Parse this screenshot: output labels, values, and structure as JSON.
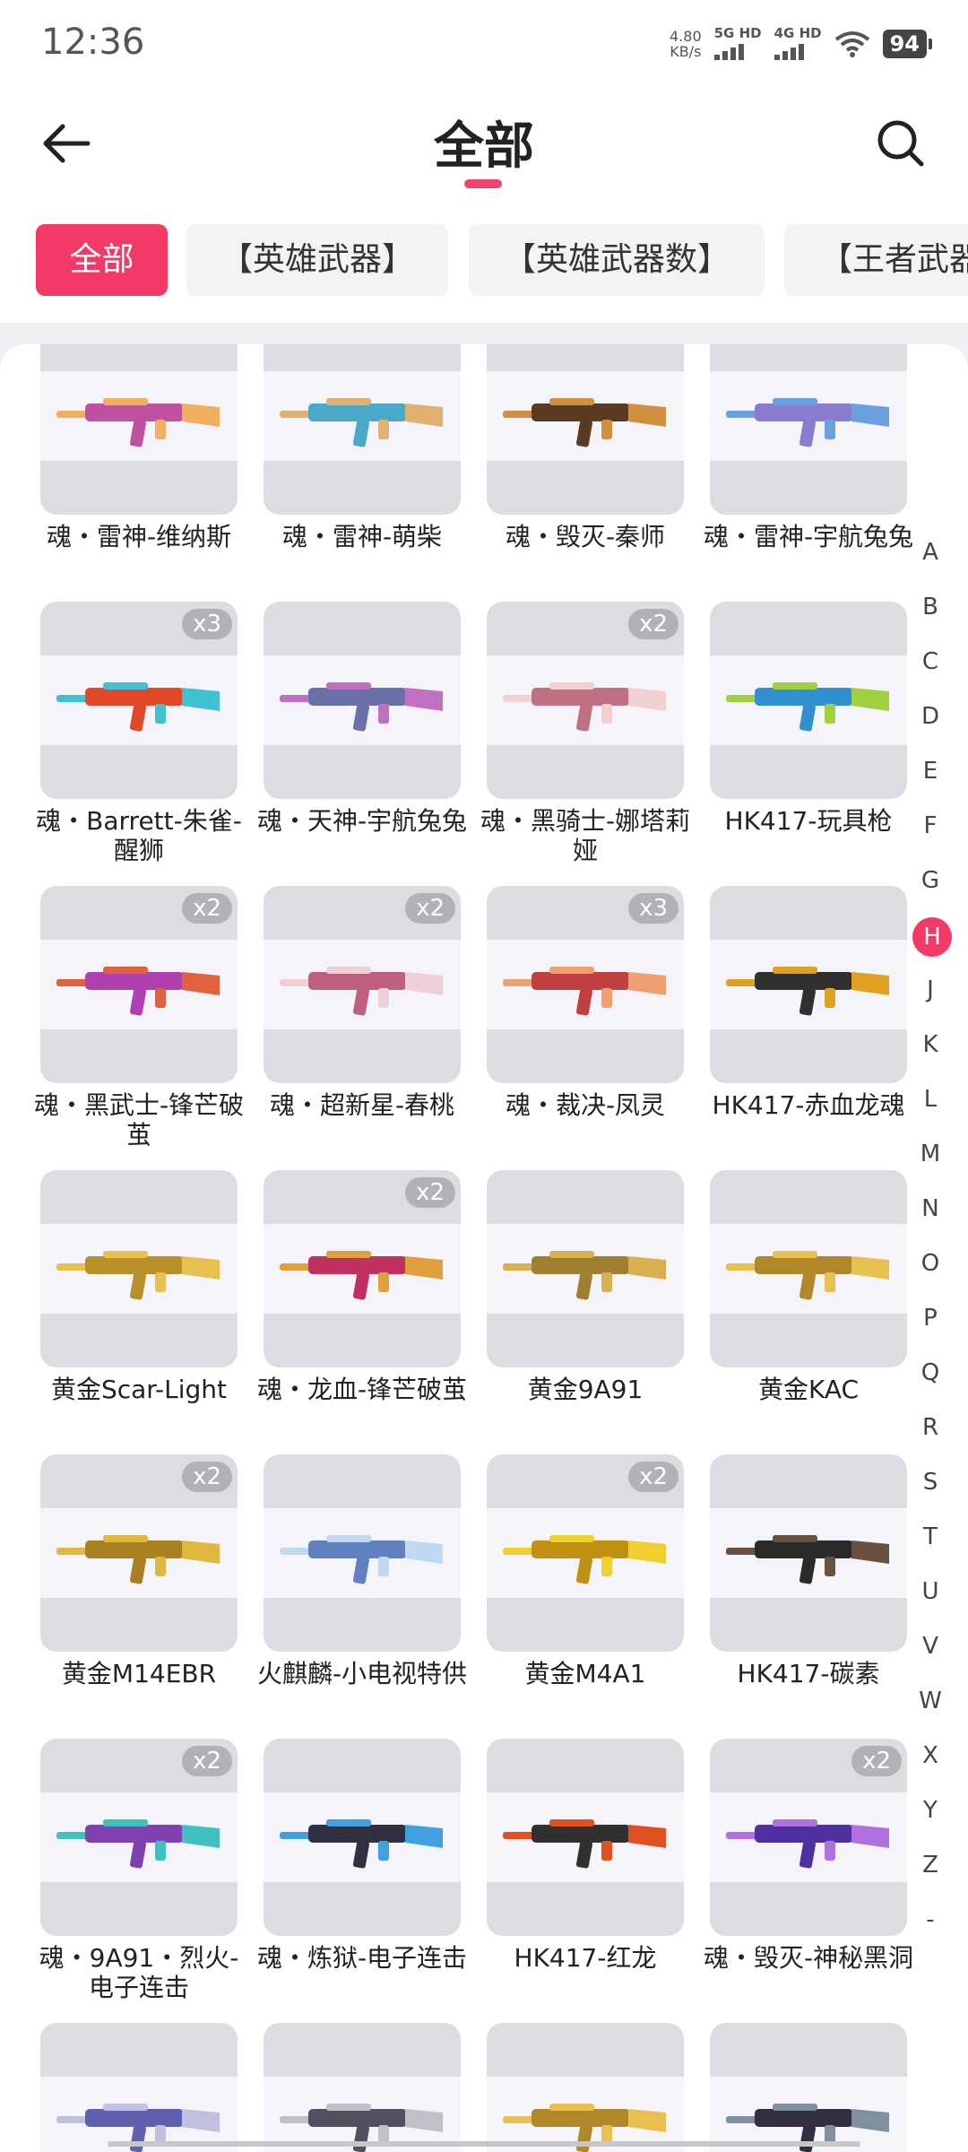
{
  "status_bar": {
    "time": "12:36",
    "net_speed_value": "4.80",
    "net_speed_unit": "KB/s",
    "sim1": "5G HD",
    "sim2": "4G HD",
    "battery": "94"
  },
  "header": {
    "title": "全部",
    "back_icon": "back-arrow-icon",
    "search_icon": "search-icon"
  },
  "tabs": [
    {
      "label": "全部",
      "active": true
    },
    {
      "label": "【英雄武器】",
      "active": false
    },
    {
      "label": "【英雄武器数】",
      "active": false
    },
    {
      "label": "【王者武器",
      "active": false
    }
  ],
  "items": [
    {
      "label": "魂・雷神-维纳斯",
      "badge": "",
      "colors": [
        "#c050a0",
        "#f0b060"
      ]
    },
    {
      "label": "魂・雷神-萌柴",
      "badge": "",
      "colors": [
        "#4aa8c8",
        "#e0b070"
      ]
    },
    {
      "label": "魂・毁灭-秦师",
      "badge": "",
      "colors": [
        "#5a3a20",
        "#d09040"
      ]
    },
    {
      "label": "魂・雷神-宇航兔兔",
      "badge": "",
      "colors": [
        "#8a7ad0",
        "#6aa0e0"
      ]
    },
    {
      "label": "魂・Barrett-朱雀-醒狮",
      "badge": "x3",
      "colors": [
        "#e04828",
        "#40c0d0"
      ]
    },
    {
      "label": "魂・天神-宇航兔兔",
      "badge": "",
      "colors": [
        "#6a70a8",
        "#c070c0"
      ]
    },
    {
      "label": "魂・黑骑士-娜塔莉娅",
      "badge": "x2",
      "colors": [
        "#c07080",
        "#f0d0d0"
      ]
    },
    {
      "label": "HK417-玩具枪",
      "badge": "",
      "colors": [
        "#3090d0",
        "#a0d040"
      ]
    },
    {
      "label": "魂・黑武士-锋芒破茧",
      "badge": "x2",
      "colors": [
        "#b040b0",
        "#e06040"
      ]
    },
    {
      "label": "魂・超新星-春桃",
      "badge": "x2",
      "colors": [
        "#c06080",
        "#f0d0d8"
      ]
    },
    {
      "label": "魂・裁决-凤灵",
      "badge": "x3",
      "colors": [
        "#c04040",
        "#f0a070"
      ]
    },
    {
      "label": "HK417-赤血龙魂",
      "badge": "",
      "colors": [
        "#303030",
        "#e0a020"
      ]
    },
    {
      "label": "黄金Scar-Light",
      "badge": "",
      "colors": [
        "#b8902a",
        "#e8c050"
      ]
    },
    {
      "label": "魂・龙血-锋芒破茧",
      "badge": "x2",
      "colors": [
        "#c03060",
        "#e0a040"
      ]
    },
    {
      "label": "黄金9A91",
      "badge": "",
      "colors": [
        "#a08030",
        "#d8b050"
      ]
    },
    {
      "label": "黄金KAC",
      "badge": "",
      "colors": [
        "#b08828",
        "#e8c050"
      ]
    },
    {
      "label": "黄金M14EBR",
      "badge": "x2",
      "colors": [
        "#a88020",
        "#e0b840"
      ]
    },
    {
      "label": "火麒麟-小电视特供",
      "badge": "",
      "colors": [
        "#6080c0",
        "#c0d8f0"
      ]
    },
    {
      "label": "黄金M4A1",
      "badge": "x2",
      "colors": [
        "#c09010",
        "#f0d030"
      ]
    },
    {
      "label": "HK417-碳素",
      "badge": "",
      "colors": [
        "#2a2a2a",
        "#6a5040"
      ]
    },
    {
      "label": "魂・9A91・烈火-电子连击",
      "badge": "x2",
      "colors": [
        "#8040b0",
        "#40c0c0"
      ]
    },
    {
      "label": "魂・炼狱-电子连击",
      "badge": "",
      "colors": [
        "#303040",
        "#40a0e0"
      ]
    },
    {
      "label": "HK417-红龙",
      "badge": "",
      "colors": [
        "#303030",
        "#e05020"
      ]
    },
    {
      "label": "魂・毁灭-神秘黑洞",
      "badge": "x2",
      "colors": [
        "#5030a0",
        "#b070e0"
      ]
    },
    {
      "label": "",
      "badge": "",
      "colors": [
        "#6060b0",
        "#c0c0e0"
      ]
    },
    {
      "label": "",
      "badge": "",
      "colors": [
        "#505060",
        "#c0c0c8"
      ]
    },
    {
      "label": "",
      "badge": "",
      "colors": [
        "#b08828",
        "#e8c050"
      ]
    },
    {
      "label": "",
      "badge": "",
      "colors": [
        "#303040",
        "#8090a0"
      ]
    }
  ],
  "alphabet": [
    "A",
    "B",
    "C",
    "D",
    "E",
    "F",
    "G",
    "H",
    "J",
    "K",
    "L",
    "M",
    "N",
    "O",
    "P",
    "Q",
    "R",
    "S",
    "T",
    "U",
    "V",
    "W",
    "X",
    "Y",
    "Z",
    "-"
  ],
  "alphabet_selected": "H",
  "colors": {
    "accent": "#f33a66",
    "tab_bg": "#f1f3f5",
    "thumb_bg": "#dcdde2"
  }
}
